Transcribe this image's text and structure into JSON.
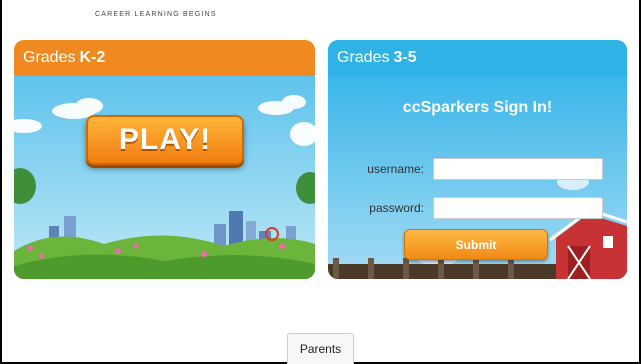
{
  "tagline": "CAREER LEARNING BEGINS",
  "left_panel": {
    "title_prefix": "Grades",
    "title_bold": "K-2",
    "play_label": "PLAY!"
  },
  "right_panel": {
    "title_prefix": "Grades",
    "title_bold": "3-5",
    "signin_title": "ccSparkers Sign In!",
    "username_label": "username:",
    "password_label": "password:",
    "username_value": "",
    "password_value": "",
    "submit_label": "Submit"
  },
  "footer": {
    "parents_label": "Parents"
  },
  "colors": {
    "k2_header": "#f08a20",
    "g35_header": "#2fb3e6",
    "button_orange": "#f08a12"
  }
}
